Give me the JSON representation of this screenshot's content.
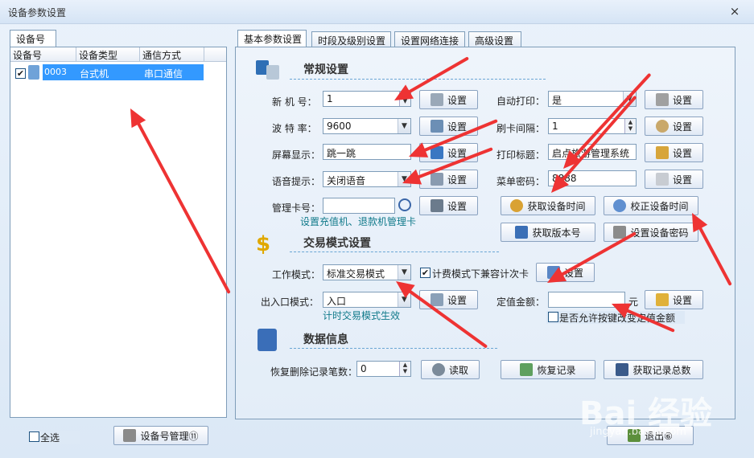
{
  "window": {
    "title": "设备参数设置",
    "close": "×"
  },
  "left": {
    "tab": "设备号",
    "columns": [
      "设备号",
      "设备类型",
      "通信方式"
    ],
    "rows": [
      {
        "checked": "✔",
        "id": "0003",
        "type": "台式机",
        "comm": "串口通信"
      }
    ],
    "select_all": "全选",
    "manage_button": "设备号管理⑪"
  },
  "tabs": [
    "基本参数设置",
    "时段及级别设置",
    "设置网络连接",
    "高级设置"
  ],
  "general": {
    "title": "常规设置",
    "machine_no": {
      "label": "新 机 号：",
      "value": "1",
      "button": "设置"
    },
    "baud": {
      "label": "波 特 率：",
      "value": "9600",
      "button": "设置"
    },
    "screen": {
      "label": "屏幕显示：",
      "value": "跳一跳",
      "button": "设置"
    },
    "voice": {
      "label": "语音提示：",
      "value": "关闭语音",
      "button": "设置"
    },
    "card": {
      "label": "管理卡号：",
      "value": "",
      "button": "设置",
      "hint": "设置充值机、退款机管理卡"
    },
    "auto_print": {
      "label": "自动打印：",
      "value": "是",
      "button": "设置"
    },
    "interval": {
      "label": "刷卡间隔：",
      "value": "1",
      "button": "设置"
    },
    "print_title": {
      "label": "打印标题：",
      "value": "启点旅游管理系统",
      "button": "设置"
    },
    "menu_pwd": {
      "label": "菜单密码：",
      "value": "8888",
      "button": "设置"
    },
    "get_time": "获取设备时间",
    "fix_time": "校正设备时间",
    "get_version": "获取版本号",
    "set_pwd": "设置设备密码"
  },
  "trade": {
    "title": "交易模式设置",
    "mode": {
      "label": "工作模式：",
      "value": "标准交易模式"
    },
    "compat": {
      "checked": "✔",
      "label": "计费模式下兼容计次卡"
    },
    "mode_button": "设置",
    "inout": {
      "label": "出入口模式：",
      "value": "入口",
      "button": "设置",
      "hint": "计时交易模式生效"
    },
    "fixed": {
      "label": "定值金额：",
      "value": "",
      "unit": "元",
      "button": "设置"
    },
    "allow": {
      "checked": "",
      "label": "是否允许按键改变定值金额"
    }
  },
  "data": {
    "title": "数据信息",
    "restore": {
      "label": "恢复删除记录笔数：",
      "value": "0"
    },
    "read": "读取",
    "recover": "恢复记录",
    "total": "获取记录总数"
  },
  "exit": "退出⑥",
  "watermark": {
    "main": "Bai 经验",
    "sub": "jingyan.baidu.com"
  },
  "colors": {
    "accent": "#3399ff",
    "arrow": "#ee3333",
    "hint": "#117a8b"
  }
}
